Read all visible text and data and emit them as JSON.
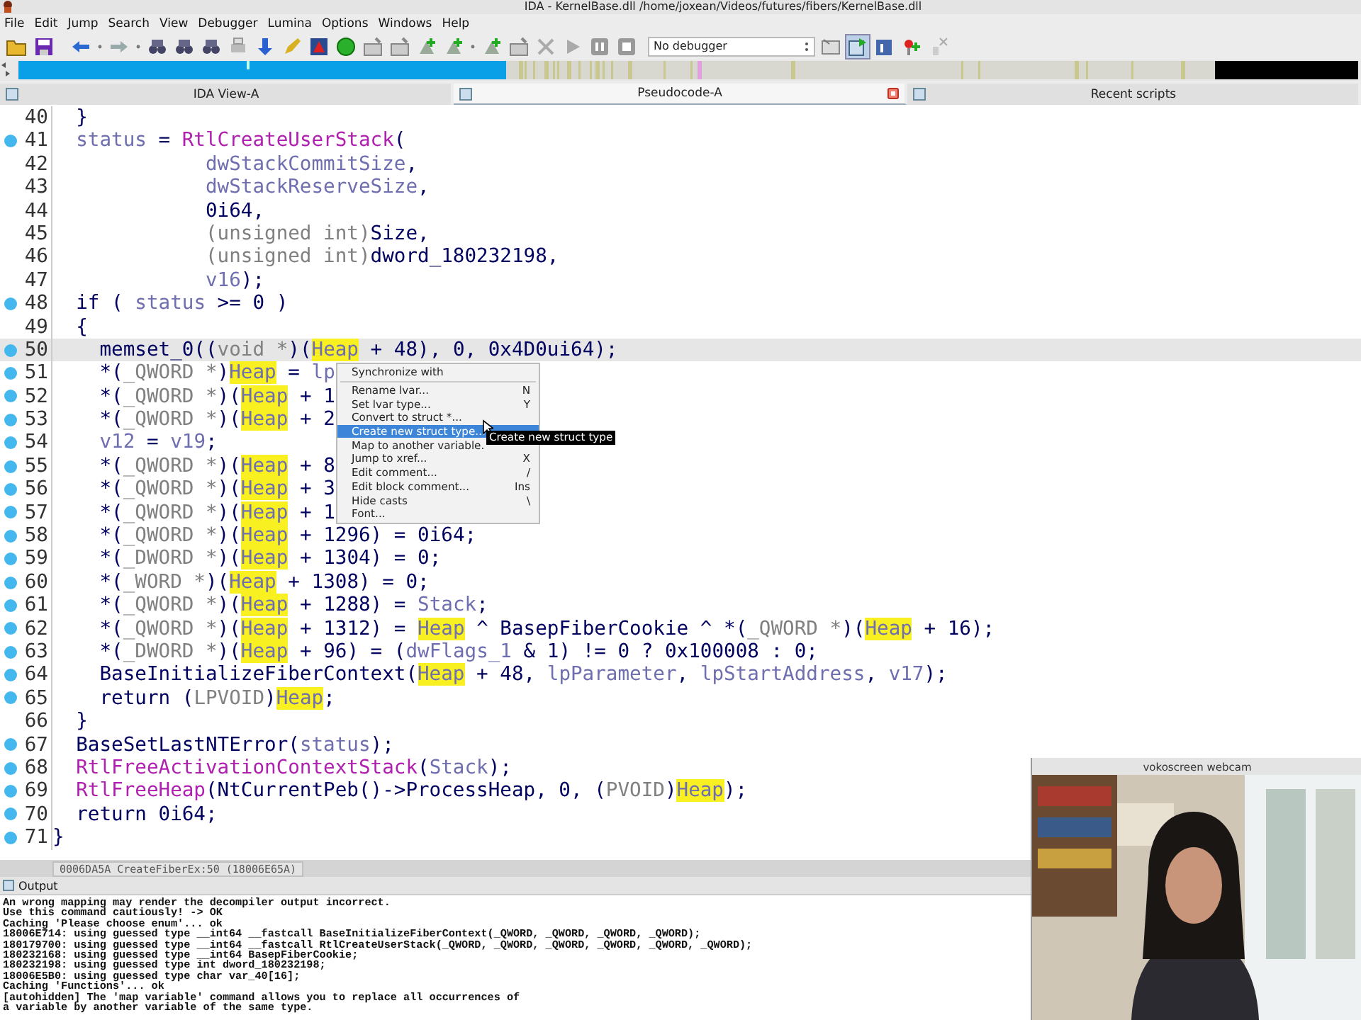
{
  "window": {
    "title": "IDA - KernelBase.dll /home/joxean/Videos/futures/fibers/KernelBase.dll"
  },
  "menus": [
    {
      "label": "File"
    },
    {
      "label": "Edit"
    },
    {
      "label": "Jump"
    },
    {
      "label": "Search"
    },
    {
      "label": "View"
    },
    {
      "label": "Debugger"
    },
    {
      "label": "Lumina"
    },
    {
      "label": "Options"
    },
    {
      "label": "Windows"
    },
    {
      "label": "Help"
    }
  ],
  "toolbar": {
    "debugger": "No debugger"
  },
  "tabs": [
    {
      "label": "IDA View-A",
      "selected": false,
      "closable": false
    },
    {
      "label": "Pseudocode-A",
      "selected": true,
      "closable": true
    },
    {
      "label": "Recent scripts",
      "selected": false,
      "closable": false
    }
  ],
  "code": {
    "lines": [
      {
        "number": "40",
        "dot": false,
        "current": false,
        "tokens": [
          {
            "kind": "plain",
            "text": "  }"
          }
        ]
      },
      {
        "number": "41",
        "dot": true,
        "current": false,
        "tokens": [
          {
            "kind": "var",
            "text": "  status"
          },
          {
            "kind": "plain",
            "text": " = "
          },
          {
            "kind": "import",
            "text": "RtlCreateUserStack"
          },
          {
            "kind": "plain",
            "text": "("
          }
        ]
      },
      {
        "number": "42",
        "dot": false,
        "current": false,
        "tokens": [
          {
            "kind": "var",
            "text": "             dwStackCommitSize"
          },
          {
            "kind": "plain",
            "text": ","
          }
        ]
      },
      {
        "number": "43",
        "dot": false,
        "current": false,
        "tokens": [
          {
            "kind": "var",
            "text": "             dwStackReserveSize"
          },
          {
            "kind": "plain",
            "text": ","
          }
        ]
      },
      {
        "number": "44",
        "dot": false,
        "current": false,
        "tokens": [
          {
            "kind": "plain",
            "text": "             0i64,"
          }
        ]
      },
      {
        "number": "45",
        "dot": false,
        "current": false,
        "tokens": [
          {
            "kind": "cast",
            "text": "             (unsigned int)"
          },
          {
            "kind": "plain",
            "text": "Size,"
          }
        ]
      },
      {
        "number": "46",
        "dot": false,
        "current": false,
        "tokens": [
          {
            "kind": "cast",
            "text": "             (unsigned int)"
          },
          {
            "kind": "plain",
            "text": "dword_180232198,"
          }
        ]
      },
      {
        "number": "47",
        "dot": false,
        "current": false,
        "tokens": [
          {
            "kind": "var",
            "text": "             v16"
          },
          {
            "kind": "plain",
            "text": ");"
          }
        ]
      },
      {
        "number": "48",
        "dot": true,
        "current": false,
        "tokens": [
          {
            "kind": "plain",
            "text": "  if ( "
          },
          {
            "kind": "var",
            "text": "status"
          },
          {
            "kind": "plain",
            "text": " >= 0 )"
          }
        ]
      },
      {
        "number": "49",
        "dot": false,
        "current": false,
        "tokens": [
          {
            "kind": "plain",
            "text": "  {"
          }
        ]
      },
      {
        "number": "50",
        "dot": true,
        "current": true,
        "tokens": [
          {
            "kind": "plain",
            "text": "    memset_0(("
          },
          {
            "kind": "cast",
            "text": "void *"
          },
          {
            "kind": "plain",
            "text": ")("
          },
          {
            "kind": "highlight",
            "text": "Heap"
          },
          {
            "kind": "plain",
            "text": " + 48), 0, 0x4D0ui64);"
          }
        ]
      },
      {
        "number": "51",
        "dot": true,
        "current": false,
        "tokens": [
          {
            "kind": "plain",
            "text": "    *("
          },
          {
            "kind": "cast",
            "text": "_QWORD *"
          },
          {
            "kind": "plain",
            "text": ")"
          },
          {
            "kind": "highlight",
            "text": "Heap"
          },
          {
            "kind": "plain",
            "text": " = "
          },
          {
            "kind": "var",
            "text": "lp"
          }
        ]
      },
      {
        "number": "52",
        "dot": true,
        "current": false,
        "tokens": [
          {
            "kind": "plain",
            "text": "    *("
          },
          {
            "kind": "cast",
            "text": "_QWORD *"
          },
          {
            "kind": "plain",
            "text": ")("
          },
          {
            "kind": "highlight",
            "text": "Heap"
          },
          {
            "kind": "plain",
            "text": " + 1"
          }
        ]
      },
      {
        "number": "53",
        "dot": true,
        "current": false,
        "tokens": [
          {
            "kind": "plain",
            "text": "    *("
          },
          {
            "kind": "cast",
            "text": "_QWORD *"
          },
          {
            "kind": "plain",
            "text": ")("
          },
          {
            "kind": "highlight",
            "text": "Heap"
          },
          {
            "kind": "plain",
            "text": " + 2"
          }
        ]
      },
      {
        "number": "54",
        "dot": true,
        "current": false,
        "tokens": [
          {
            "kind": "var",
            "text": "    v12"
          },
          {
            "kind": "plain",
            "text": " = "
          },
          {
            "kind": "var",
            "text": "v19"
          },
          {
            "kind": "plain",
            "text": ";"
          }
        ]
      },
      {
        "number": "55",
        "dot": true,
        "current": false,
        "tokens": [
          {
            "kind": "plain",
            "text": "    *("
          },
          {
            "kind": "cast",
            "text": "_QWORD *"
          },
          {
            "kind": "plain",
            "text": ")("
          },
          {
            "kind": "highlight",
            "text": "Heap"
          },
          {
            "kind": "plain",
            "text": " + 8"
          }
        ]
      },
      {
        "number": "56",
        "dot": true,
        "current": false,
        "tokens": [
          {
            "kind": "plain",
            "text": "    *("
          },
          {
            "kind": "cast",
            "text": "_QWORD *"
          },
          {
            "kind": "plain",
            "text": ")("
          },
          {
            "kind": "highlight",
            "text": "Heap"
          },
          {
            "kind": "plain",
            "text": " + 3"
          }
        ]
      },
      {
        "number": "57",
        "dot": true,
        "current": false,
        "tokens": [
          {
            "kind": "plain",
            "text": "    *("
          },
          {
            "kind": "cast",
            "text": "_QWORD *"
          },
          {
            "kind": "plain",
            "text": ")("
          },
          {
            "kind": "highlight",
            "text": "Heap"
          },
          {
            "kind": "plain",
            "text": " + 1"
          }
        ]
      },
      {
        "number": "58",
        "dot": true,
        "current": false,
        "tokens": [
          {
            "kind": "plain",
            "text": "    *("
          },
          {
            "kind": "cast",
            "text": "_QWORD *"
          },
          {
            "kind": "plain",
            "text": ")("
          },
          {
            "kind": "highlight",
            "text": "Heap"
          },
          {
            "kind": "plain",
            "text": " + 1296) = 0i64;"
          }
        ]
      },
      {
        "number": "59",
        "dot": true,
        "current": false,
        "tokens": [
          {
            "kind": "plain",
            "text": "    *("
          },
          {
            "kind": "cast",
            "text": "_DWORD *"
          },
          {
            "kind": "plain",
            "text": ")("
          },
          {
            "kind": "highlight",
            "text": "Heap"
          },
          {
            "kind": "plain",
            "text": " + 1304) = 0;"
          }
        ]
      },
      {
        "number": "60",
        "dot": true,
        "current": false,
        "tokens": [
          {
            "kind": "plain",
            "text": "    *("
          },
          {
            "kind": "cast",
            "text": "_WORD *"
          },
          {
            "kind": "plain",
            "text": ")("
          },
          {
            "kind": "highlight",
            "text": "Heap"
          },
          {
            "kind": "plain",
            "text": " + 1308) = 0;"
          }
        ]
      },
      {
        "number": "61",
        "dot": true,
        "current": false,
        "tokens": [
          {
            "kind": "plain",
            "text": "    *("
          },
          {
            "kind": "cast",
            "text": "_QWORD *"
          },
          {
            "kind": "plain",
            "text": ")("
          },
          {
            "kind": "highlight",
            "text": "Heap"
          },
          {
            "kind": "plain",
            "text": " + 1288) = "
          },
          {
            "kind": "var",
            "text": "Stack"
          },
          {
            "kind": "plain",
            "text": ";"
          }
        ]
      },
      {
        "number": "62",
        "dot": true,
        "current": false,
        "tokens": [
          {
            "kind": "plain",
            "text": "    *("
          },
          {
            "kind": "cast",
            "text": "_QWORD *"
          },
          {
            "kind": "plain",
            "text": ")("
          },
          {
            "kind": "highlight",
            "text": "Heap"
          },
          {
            "kind": "plain",
            "text": " + 1312) = "
          },
          {
            "kind": "highlight",
            "text": "Heap"
          },
          {
            "kind": "plain",
            "text": " ^ BasepFiberCookie ^ *("
          },
          {
            "kind": "cast",
            "text": "_QWORD *"
          },
          {
            "kind": "plain",
            "text": ")("
          },
          {
            "kind": "highlight",
            "text": "Heap"
          },
          {
            "kind": "plain",
            "text": " + 16);"
          }
        ]
      },
      {
        "number": "63",
        "dot": true,
        "current": false,
        "tokens": [
          {
            "kind": "plain",
            "text": "    *("
          },
          {
            "kind": "cast",
            "text": "_DWORD *"
          },
          {
            "kind": "plain",
            "text": ")("
          },
          {
            "kind": "highlight",
            "text": "Heap"
          },
          {
            "kind": "plain",
            "text": " + 96) = ("
          },
          {
            "kind": "var",
            "text": "dwFlags_1"
          },
          {
            "kind": "plain",
            "text": " & 1) != 0 ? 0x100008 : 0;"
          }
        ]
      },
      {
        "number": "64",
        "dot": true,
        "current": false,
        "tokens": [
          {
            "kind": "plain",
            "text": "    BaseInitializeFiberContext("
          },
          {
            "kind": "highlight",
            "text": "Heap"
          },
          {
            "kind": "plain",
            "text": " + 48, "
          },
          {
            "kind": "var",
            "text": "lpParameter"
          },
          {
            "kind": "plain",
            "text": ", "
          },
          {
            "kind": "var",
            "text": "lpStartAddress"
          },
          {
            "kind": "plain",
            "text": ", "
          },
          {
            "kind": "var",
            "text": "v17"
          },
          {
            "kind": "plain",
            "text": ");"
          }
        ]
      },
      {
        "number": "65",
        "dot": true,
        "current": false,
        "tokens": [
          {
            "kind": "plain",
            "text": "    return ("
          },
          {
            "kind": "cast",
            "text": "LPVOID"
          },
          {
            "kind": "plain",
            "text": ")"
          },
          {
            "kind": "highlight",
            "text": "Heap"
          },
          {
            "kind": "plain",
            "text": ";"
          }
        ]
      },
      {
        "number": "66",
        "dot": false,
        "current": false,
        "tokens": [
          {
            "kind": "plain",
            "text": "  }"
          }
        ]
      },
      {
        "number": "67",
        "dot": true,
        "current": false,
        "tokens": [
          {
            "kind": "plain",
            "text": "  BaseSetLastNTError("
          },
          {
            "kind": "var",
            "text": "status"
          },
          {
            "kind": "plain",
            "text": ");"
          }
        ]
      },
      {
        "number": "68",
        "dot": true,
        "current": false,
        "tokens": [
          {
            "kind": "import",
            "text": "  RtlFreeActivationContextStack"
          },
          {
            "kind": "plain",
            "text": "("
          },
          {
            "kind": "var",
            "text": "Stack"
          },
          {
            "kind": "plain",
            "text": ");"
          }
        ]
      },
      {
        "number": "69",
        "dot": true,
        "current": false,
        "tokens": [
          {
            "kind": "import",
            "text": "  RtlFreeHeap"
          },
          {
            "kind": "plain",
            "text": "(NtCurrentPeb()->ProcessHeap, 0, ("
          },
          {
            "kind": "cast",
            "text": "PVOID"
          },
          {
            "kind": "plain",
            "text": ")"
          },
          {
            "kind": "highlight",
            "text": "Heap"
          },
          {
            "kind": "plain",
            "text": ");"
          }
        ]
      },
      {
        "number": "70",
        "dot": true,
        "current": false,
        "tokens": [
          {
            "kind": "plain",
            "text": "  return 0i64;"
          }
        ]
      },
      {
        "number": "71",
        "dot": true,
        "current": false,
        "tokens": [
          {
            "kind": "plain",
            "text": "}"
          }
        ]
      }
    ]
  },
  "context_menu": {
    "sections": [
      [
        {
          "label": "Synchronize with",
          "selected": false
        }
      ],
      [
        {
          "label": "Rename lvar...",
          "shortcut": "N",
          "selected": false
        },
        {
          "label": "Set lvar type...",
          "shortcut": "Y",
          "selected": false
        },
        {
          "label": "Convert to struct *...",
          "selected": false
        },
        {
          "label": "Create new struct type...",
          "selected": true
        },
        {
          "label": "Map to another variable.",
          "selected": false
        },
        {
          "label": "Jump to xref...",
          "shortcut": "X",
          "selected": false
        },
        {
          "label": "Edit comment...",
          "shortcut": "/",
          "selected": false
        },
        {
          "label": "Edit block comment...",
          "shortcut": "Ins",
          "selected": false
        },
        {
          "label": "Hide casts",
          "shortcut": "\\",
          "selected": false
        },
        {
          "label": "Font...",
          "selected": false
        }
      ]
    ]
  },
  "tooltip": "Create new struct type",
  "status_line": "0006DA5A CreateFiberEx:50 (18006E65A)",
  "output": {
    "title": "Output",
    "lines": [
      "An wrong mapping may render the decompiler output incorrect.",
      "Use this command cautiously! -> OK",
      "Caching 'Please choose enum'... ok",
      "18006E714: using guessed type __int64 __fastcall BaseInitializeFiberContext(_QWORD, _QWORD, _QWORD, _QWORD);",
      "180179700: using guessed type __int64 __fastcall RtlCreateUserStack(_QWORD, _QWORD, _QWORD, _QWORD, _QWORD, _QWORD);",
      "180232168: using guessed type __int64 BasepFiberCookie;",
      "180232198: using guessed type int dword_180232198;",
      "18006E5B0: using guessed type char var_40[16];",
      "Caching 'Functions'... ok",
      "[autohidden] The 'map variable' command allows you to replace all occurrences of",
      "a variable by another variable of the same type."
    ]
  },
  "webcam": {
    "title": "vokoscreen webcam",
    "kind": "picture"
  }
}
